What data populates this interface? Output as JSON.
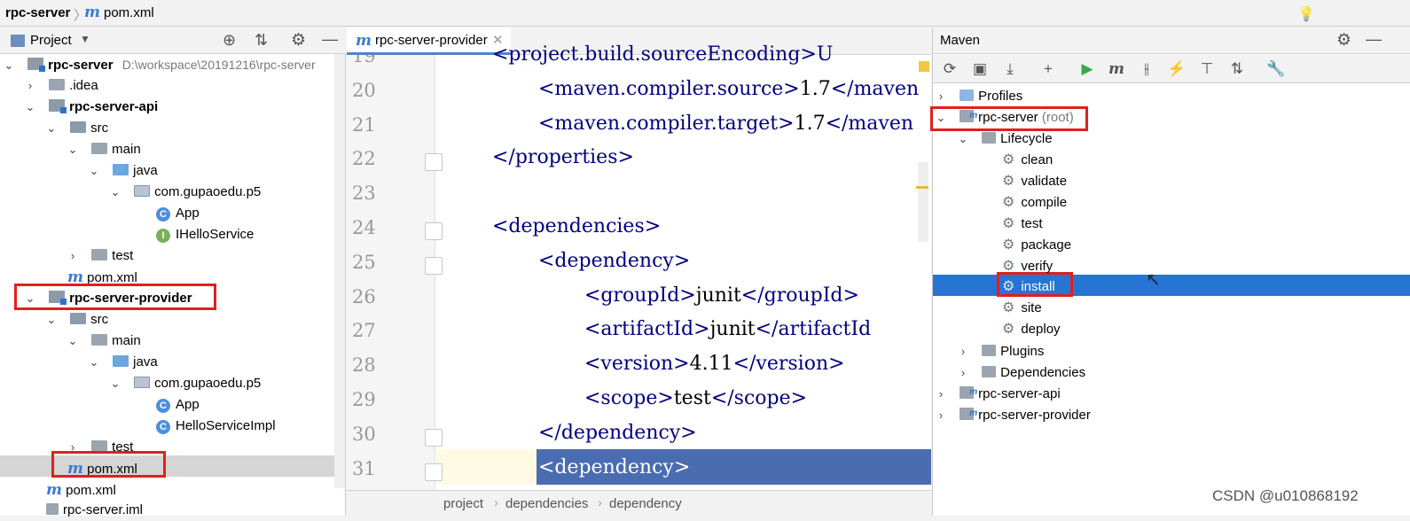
{
  "breadcrumb": {
    "project": "rpc-server",
    "file": "pom.xml"
  },
  "project_panel": {
    "title": "Project",
    "rows": [
      {
        "label": "rpc-server",
        "path": "D:\\workspace\\20191216\\rpc-server"
      },
      {
        "label": ".idea"
      },
      {
        "label": "rpc-server-api"
      },
      {
        "label": "src"
      },
      {
        "label": "main"
      },
      {
        "label": "java"
      },
      {
        "label": "com.gupaoedu.p5"
      },
      {
        "label": "App"
      },
      {
        "label": "IHelloService"
      },
      {
        "label": "test"
      },
      {
        "label": "pom.xml"
      },
      {
        "label": "rpc-server-provider"
      },
      {
        "label": "src"
      },
      {
        "label": "main"
      },
      {
        "label": "java"
      },
      {
        "label": "com.gupaoedu.p5"
      },
      {
        "label": "App"
      },
      {
        "label": "HelloServiceImpl"
      },
      {
        "label": "test"
      },
      {
        "label": "pom.xml"
      },
      {
        "label": "pom.xml"
      },
      {
        "label": "rpc-server.iml"
      }
    ]
  },
  "editor": {
    "tab_label": "rpc-server-provider",
    "lines": [
      {
        "num": "19",
        "text": "<project.build.sourceEncoding>U"
      },
      {
        "num": "20",
        "open": "<maven.compiler.source>",
        "value": "1.7",
        "close": "</maven"
      },
      {
        "num": "21",
        "open": "<maven.compiler.target>",
        "value": "1.7",
        "close": "</maven"
      },
      {
        "num": "22",
        "text": "</properties>"
      },
      {
        "num": "23",
        "text": ""
      },
      {
        "num": "24",
        "text": "<dependencies>"
      },
      {
        "num": "25",
        "text": "<dependency>"
      },
      {
        "num": "26",
        "open": "<groupId>",
        "value": "junit",
        "close": "</groupId>"
      },
      {
        "num": "27",
        "open": "<artifactId>",
        "value": "junit",
        "close": "</artifactId"
      },
      {
        "num": "28",
        "open": "<version>",
        "value": "4.11",
        "close": "</version>"
      },
      {
        "num": "29",
        "open": "<scope>",
        "value": "test",
        "close": "</scope>"
      },
      {
        "num": "30",
        "text": "</dependency>"
      },
      {
        "num": "31",
        "text": "<dependency>"
      }
    ],
    "crumbs": [
      "project",
      "dependencies",
      "dependency"
    ]
  },
  "maven_panel": {
    "title": "Maven",
    "profiles": "Profiles",
    "root_project": "rpc-server",
    "root_suffix": "(root)",
    "lifecycle": "Lifecycle",
    "phases": [
      "clean",
      "validate",
      "compile",
      "test",
      "package",
      "verify",
      "install",
      "site",
      "deploy"
    ],
    "selected_phase": "install",
    "plugins": "Plugins",
    "dependencies": "Dependencies",
    "modules": [
      "rpc-server-api",
      "rpc-server-provider"
    ]
  },
  "watermark": "CSDN @u010868192",
  "colors": {
    "highlight": "#e0201e",
    "selection": "#2675d4",
    "tag": "#000080"
  }
}
